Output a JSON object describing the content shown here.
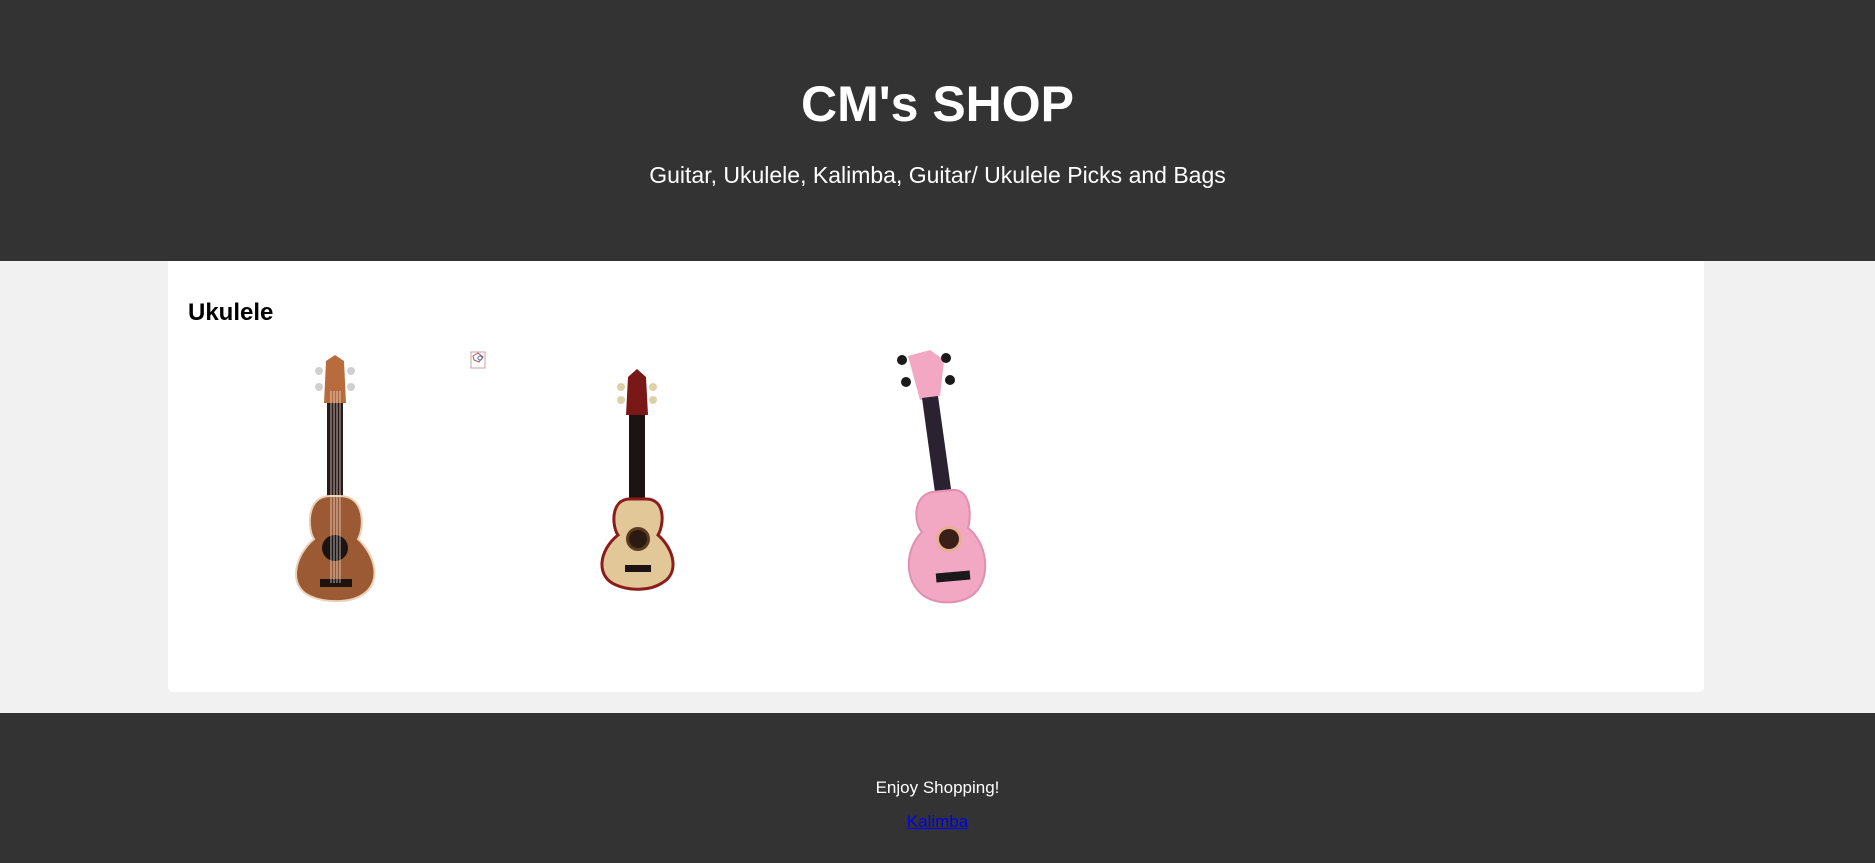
{
  "header": {
    "title": "CM's SHOP",
    "tagline": "Guitar, Ukulele, Kalimba, Guitar/ Ukulele Picks and Bags"
  },
  "section": {
    "heading": "Ukulele"
  },
  "products": [
    {
      "name": "mahogany-soprano-ukulele",
      "body_color": "#9b5a34",
      "head_color": "#b26b40"
    },
    {
      "name": "natural-wood-soprano-ukulele",
      "body_color": "#e2c898",
      "head_color": "#7a1818"
    },
    {
      "name": "pink-soprano-ukulele",
      "body_color": "#f2a7c3",
      "head_color": "#f2a7c3"
    }
  ],
  "footer": {
    "text": "Enjoy Shopping!",
    "link_label": "Kalimba"
  }
}
